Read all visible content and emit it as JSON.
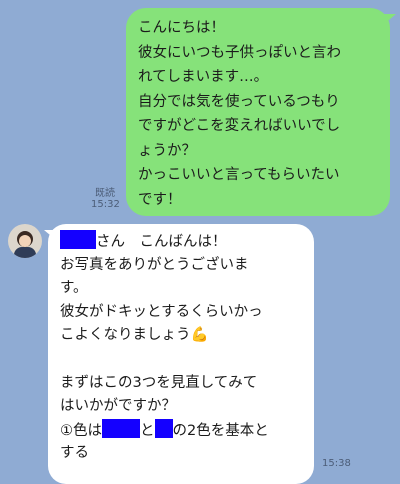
{
  "outgoing": {
    "lines": [
      "こんにちは！",
      "彼女にいつも子供っぽいと言わ",
      "れてしまいます…。",
      "自分では気を使っているつもり",
      "ですがどこを変えればいいでし",
      "ょうか？",
      "かっこいいと言ってもらいたい",
      "です！"
    ],
    "read_label": "既読",
    "time": "15:32"
  },
  "incoming": {
    "avatar": "user-avatar",
    "greeting": "さん　こんばんは！",
    "line2": "お写真をありがとうございま",
    "line3": "す。",
    "line4": "彼女がドキッとするくらいかっ",
    "line5": "こよくなりましょう",
    "emoji": "💪",
    "line7": "まずはこの3つを見直してみて",
    "line8": "はいかがですか？",
    "line9_a": "①色は",
    "line9_b": "と",
    "line9_c": "の2色を基本と",
    "line10": "する",
    "time": "15:38"
  },
  "colors": {
    "background": "#8fabd3",
    "outgoing_bubble": "#86e27a",
    "incoming_bubble": "#ffffff",
    "redaction": "#1400ff"
  }
}
